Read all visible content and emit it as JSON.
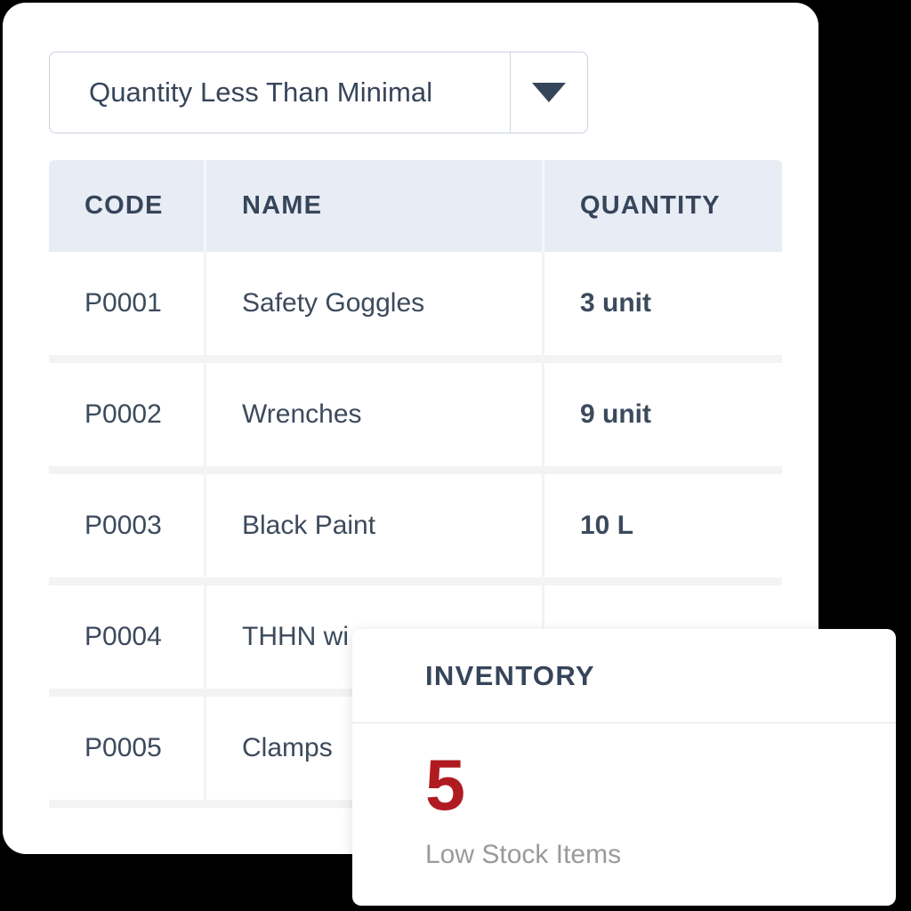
{
  "filter": {
    "selected_value": "Quantity Less Than Minimal",
    "caret_icon": "chevron-down-icon"
  },
  "table": {
    "columns": [
      "CODE",
      "NAME",
      "QUANTITY"
    ],
    "rows": [
      {
        "code": "P0001",
        "name": "Safety Goggles",
        "quantity": "3 unit"
      },
      {
        "code": "P0002",
        "name": "Wrenches",
        "quantity": "9 unit"
      },
      {
        "code": "P0003",
        "name": "Black Paint",
        "quantity": "10 L"
      },
      {
        "code": "P0004",
        "name": "THHN wi",
        "quantity": ""
      },
      {
        "code": "P0005",
        "name": "Clamps",
        "quantity": ""
      }
    ]
  },
  "inventory_card": {
    "title": "INVENTORY",
    "count": "5",
    "subtitle": "Low Stock Items"
  },
  "colors": {
    "accent_red": "#b01b21",
    "text_dark": "#36455a",
    "header_bg": "#e8ecf4",
    "muted_gray": "#9a9a9a",
    "border": "#c8d2e0",
    "backdrop": "#000000"
  }
}
